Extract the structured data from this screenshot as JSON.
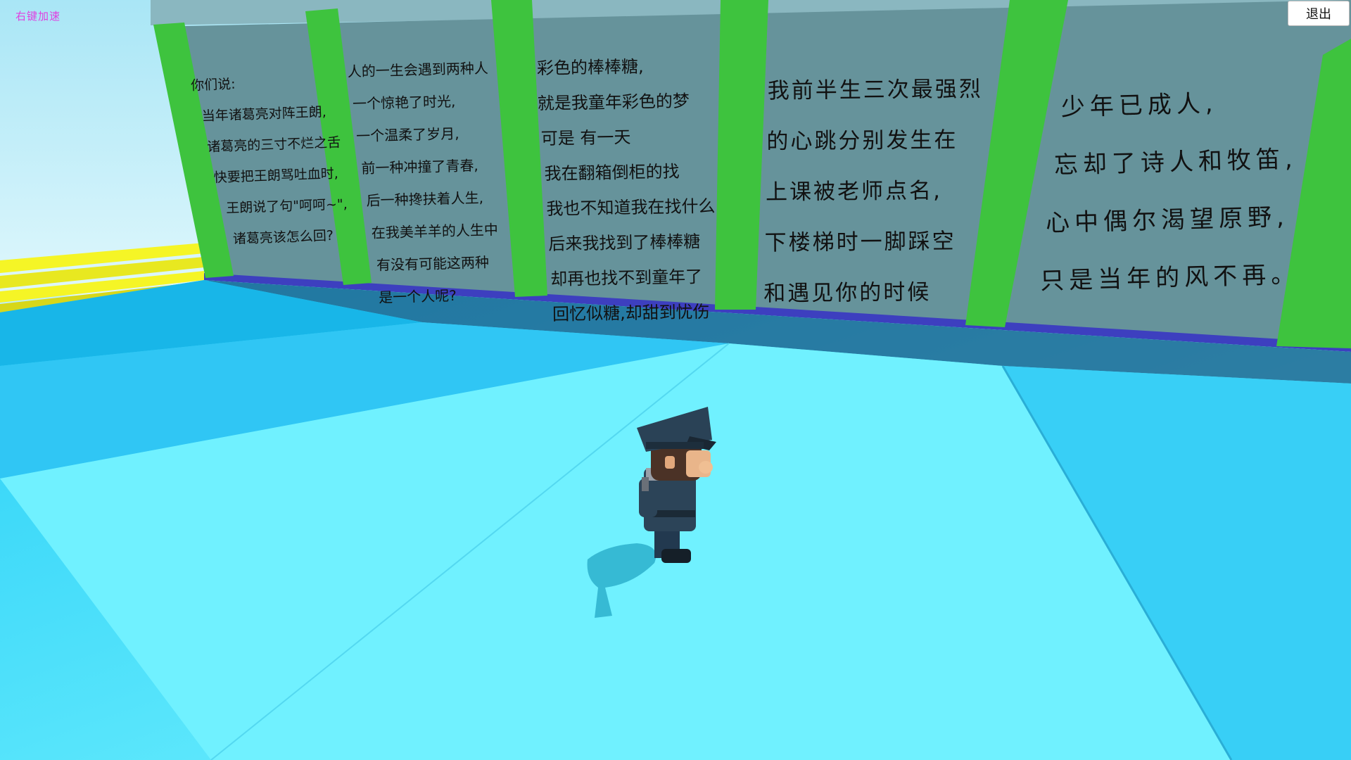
{
  "hud": {
    "hint_text": "右键加速",
    "exit_label": "退出"
  },
  "colors": {
    "sky": "#c4f0fa",
    "floor_light": "#6ff1ff",
    "floor_mid": "#33d3f5",
    "floor_dark": "#18b6e8",
    "wall": "#66939b",
    "pillar": "#3ec33e",
    "rail": "#f5f526",
    "wall_base": "#3d3fbf"
  },
  "wall_panels": [
    {
      "lines": [
        "你们说:",
        "当年诸葛亮对阵王朗,",
        "诸葛亮的三寸不烂之舌",
        "快要把王朗骂吐血时,",
        "王朗说了句\"呵呵~\",",
        "诸葛亮该怎么回?"
      ]
    },
    {
      "lines": [
        "人的一生会遇到两种人",
        "一个惊艳了时光,",
        "一个温柔了岁月,",
        "前一种冲撞了青春,",
        "后一种搀扶着人生,",
        "在我美羊羊的人生中",
        "有没有可能这两种",
        "是一个人呢?"
      ]
    },
    {
      "lines": [
        "彩色的棒棒糖,",
        "就是我童年彩色的梦",
        "可是  有一天",
        "我在翻箱倒柜的找",
        "我也不知道我在找什么",
        "后来我找到了棒棒糖",
        "却再也找不到童年了",
        "回忆似糖,却甜到忧伤"
      ]
    },
    {
      "lines": [
        "我前半生三次最强烈",
        "的心跳分别发生在",
        "上课被老师点名,",
        "下楼梯时一脚踩空",
        "和遇见你的时候"
      ]
    },
    {
      "lines": [
        "少年已成人,",
        "忘却了诗人和牧笛,",
        "心中偶尔渴望原野,",
        "只是当年的风不再。"
      ]
    }
  ],
  "player": {
    "character": "police-officer"
  }
}
